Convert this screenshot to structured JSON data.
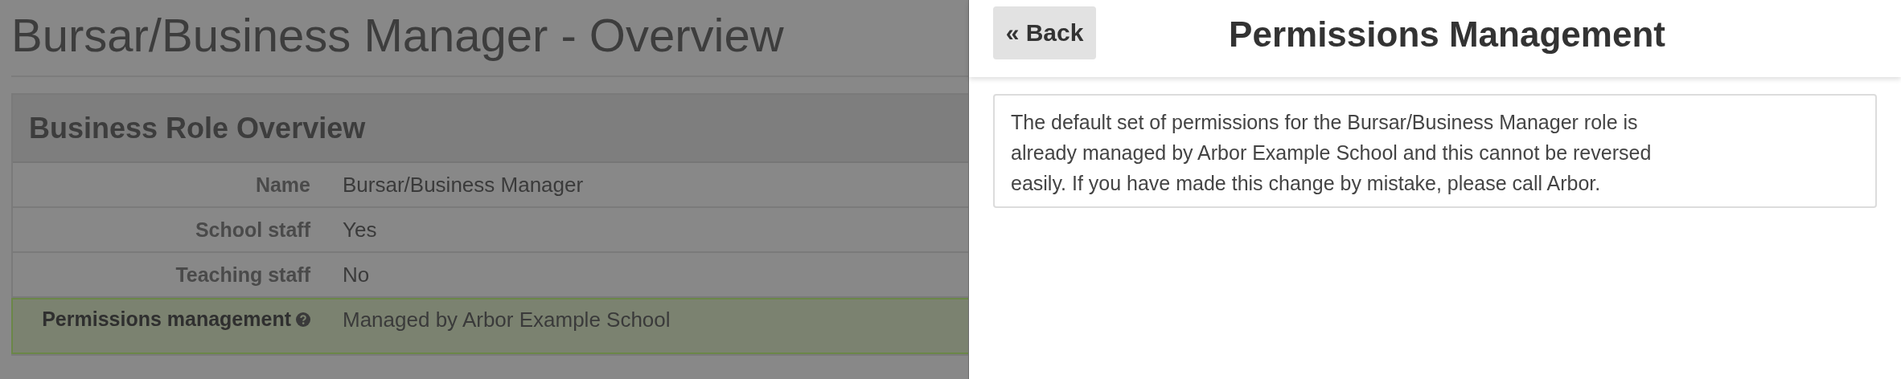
{
  "background_page": {
    "title": "Bursar/Business Manager - Overview",
    "card": {
      "title": "Business Role Overview",
      "rows": [
        {
          "label": "Name",
          "value": "Bursar/Business Manager",
          "highlighted": false,
          "help": false
        },
        {
          "label": "School staff",
          "value": "Yes",
          "highlighted": false,
          "help": false
        },
        {
          "label": "Teaching staff",
          "value": "No",
          "highlighted": false,
          "help": false
        },
        {
          "label": "Permissions management",
          "value": "Managed by Arbor Example School",
          "highlighted": true,
          "help": true
        }
      ]
    }
  },
  "panel": {
    "back_button": "« Back",
    "title": "Permissions Management",
    "message": "The default set of permissions for the Bursar/Business Manager role is already managed by Arbor Example School and this cannot be reversed easily. If you have made this change by mistake, please call Arbor."
  }
}
